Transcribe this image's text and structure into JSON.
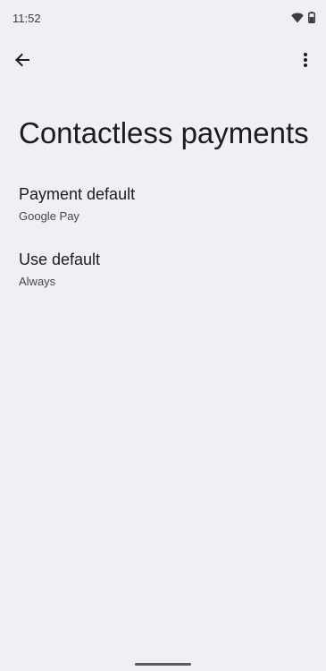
{
  "status_bar": {
    "time": "11:52",
    "icons": [
      "wifi-icon",
      "battery-icon"
    ]
  },
  "app_bar": {
    "back_icon": "arrow-back-icon",
    "more_icon": "more-vert-icon"
  },
  "page": {
    "title": "Contactless payments"
  },
  "preferences": [
    {
      "title": "Payment default",
      "summary": "Google Pay"
    },
    {
      "title": "Use default",
      "summary": "Always"
    }
  ],
  "colors": {
    "background": "#f1eef4",
    "text_primary": "#1c1b1f",
    "text_secondary": "#49454f"
  }
}
